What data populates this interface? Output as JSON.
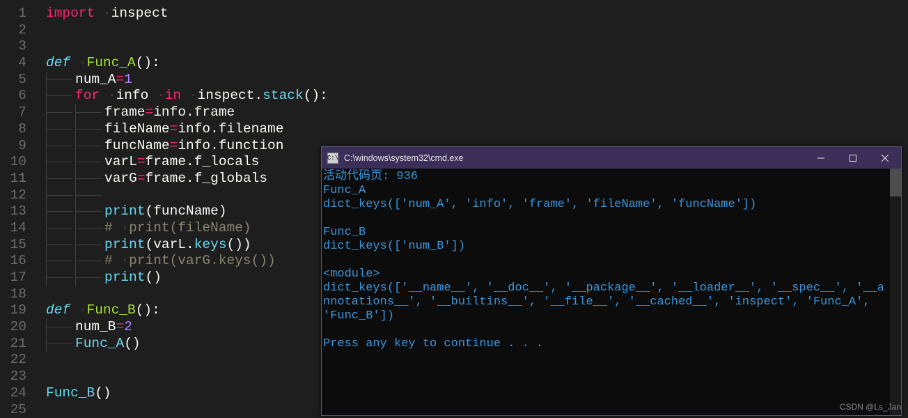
{
  "editor": {
    "lines": [
      {
        "n": 1,
        "seg": [
          [
            "kw-import",
            "import"
          ],
          [
            "ws",
            " "
          ],
          [
            "ws-dot",
            "·"
          ],
          [
            "ident",
            "inspect"
          ]
        ]
      },
      {
        "n": 2,
        "seg": []
      },
      {
        "n": 3,
        "seg": []
      },
      {
        "n": 4,
        "seg": [
          [
            "kw-def",
            "def"
          ],
          [
            "ws",
            " "
          ],
          [
            "ws-dot",
            "·"
          ],
          [
            "fn-name",
            "Func_A"
          ],
          [
            "paren",
            "()"
          ],
          [
            "ident",
            ":"
          ]
        ]
      },
      {
        "n": 5,
        "seg": [
          [
            "guide",
            1
          ],
          [
            "ident",
            "num_A"
          ],
          [
            "op",
            "="
          ],
          [
            "num-lit",
            "1"
          ]
        ]
      },
      {
        "n": 6,
        "seg": [
          [
            "guide",
            1
          ],
          [
            "kw-for",
            "for"
          ],
          [
            "ws",
            " "
          ],
          [
            "ws-dot",
            "·"
          ],
          [
            "ident",
            "info"
          ],
          [
            "ws",
            " "
          ],
          [
            "ws-dot",
            "·"
          ],
          [
            "kw-in",
            "in"
          ],
          [
            "ws",
            " "
          ],
          [
            "ws-dot",
            "·"
          ],
          [
            "ident",
            "inspect"
          ],
          [
            "dot",
            "."
          ],
          [
            "call-fn",
            "stack"
          ],
          [
            "paren",
            "()"
          ],
          [
            "ident",
            ":"
          ]
        ]
      },
      {
        "n": 7,
        "seg": [
          [
            "guide",
            2
          ],
          [
            "ident",
            "frame"
          ],
          [
            "op",
            "="
          ],
          [
            "ident",
            "info"
          ],
          [
            "dot",
            "."
          ],
          [
            "ident",
            "frame"
          ]
        ]
      },
      {
        "n": 8,
        "seg": [
          [
            "guide",
            2
          ],
          [
            "ident",
            "fileName"
          ],
          [
            "op",
            "="
          ],
          [
            "ident",
            "info"
          ],
          [
            "dot",
            "."
          ],
          [
            "ident",
            "filename"
          ]
        ]
      },
      {
        "n": 9,
        "seg": [
          [
            "guide",
            2
          ],
          [
            "ident",
            "funcName"
          ],
          [
            "op",
            "="
          ],
          [
            "ident",
            "info"
          ],
          [
            "dot",
            "."
          ],
          [
            "ident",
            "function"
          ]
        ]
      },
      {
        "n": 10,
        "seg": [
          [
            "guide",
            2
          ],
          [
            "ident",
            "varL"
          ],
          [
            "op",
            "="
          ],
          [
            "ident",
            "frame"
          ],
          [
            "dot",
            "."
          ],
          [
            "ident",
            "f_locals"
          ]
        ]
      },
      {
        "n": 11,
        "seg": [
          [
            "guide",
            2
          ],
          [
            "ident",
            "varG"
          ],
          [
            "op",
            "="
          ],
          [
            "ident",
            "frame"
          ],
          [
            "dot",
            "."
          ],
          [
            "ident",
            "f_globals"
          ]
        ]
      },
      {
        "n": 12,
        "seg": [
          [
            "guide",
            2
          ]
        ]
      },
      {
        "n": 13,
        "seg": [
          [
            "guide",
            2
          ],
          [
            "call-fn",
            "print"
          ],
          [
            "paren",
            "("
          ],
          [
            "ident",
            "funcName"
          ],
          [
            "paren",
            ")"
          ]
        ]
      },
      {
        "n": 14,
        "seg": [
          [
            "guide",
            2
          ],
          [
            "comment",
            "# "
          ],
          [
            "ws-dot",
            "·"
          ],
          [
            "comment",
            "print(fileName)"
          ]
        ]
      },
      {
        "n": 15,
        "seg": [
          [
            "guide",
            2
          ],
          [
            "call-fn",
            "print"
          ],
          [
            "paren",
            "("
          ],
          [
            "ident",
            "varL"
          ],
          [
            "dot",
            "."
          ],
          [
            "call-fn",
            "keys"
          ],
          [
            "paren",
            "()"
          ],
          [
            "paren",
            ")"
          ]
        ]
      },
      {
        "n": 16,
        "seg": [
          [
            "guide",
            2
          ],
          [
            "comment",
            "# "
          ],
          [
            "ws-dot",
            "·"
          ],
          [
            "comment",
            "print(varG.keys())"
          ]
        ]
      },
      {
        "n": 17,
        "seg": [
          [
            "guide",
            2
          ],
          [
            "call-fn",
            "print"
          ],
          [
            "paren",
            "()"
          ]
        ]
      },
      {
        "n": 18,
        "seg": []
      },
      {
        "n": 19,
        "seg": [
          [
            "kw-def",
            "def"
          ],
          [
            "ws",
            " "
          ],
          [
            "ws-dot",
            "·"
          ],
          [
            "fn-name",
            "Func_B"
          ],
          [
            "paren",
            "()"
          ],
          [
            "ident",
            ":"
          ]
        ]
      },
      {
        "n": 20,
        "seg": [
          [
            "guide",
            1
          ],
          [
            "ident",
            "num_B"
          ],
          [
            "op",
            "="
          ],
          [
            "num-lit",
            "2"
          ]
        ]
      },
      {
        "n": 21,
        "seg": [
          [
            "guide",
            1
          ],
          [
            "call-fn",
            "Func_A"
          ],
          [
            "paren",
            "()"
          ]
        ]
      },
      {
        "n": 22,
        "seg": []
      },
      {
        "n": 23,
        "seg": []
      },
      {
        "n": 24,
        "seg": [
          [
            "call-fn",
            "Func_B"
          ],
          [
            "paren",
            "()"
          ]
        ]
      },
      {
        "n": 25,
        "seg": []
      }
    ]
  },
  "console": {
    "title": "C:\\windows\\system32\\cmd.exe",
    "icon_text": "C:\\",
    "output_lines": [
      "活动代码页: 936",
      "Func_A",
      "dict_keys(['num_A', 'info', 'frame', 'fileName', 'funcName'])",
      "",
      "Func_B",
      "dict_keys(['num_B'])",
      "",
      "<module>",
      "dict_keys(['__name__', '__doc__', '__package__', '__loader__', '__spec__', '__annotations__', '__builtins__', '__file__', '__cached__', 'inspect', 'Func_A', 'Func_B'])",
      "",
      "Press any key to continue . . ."
    ]
  },
  "watermark": "CSDN @Ls_Jan"
}
